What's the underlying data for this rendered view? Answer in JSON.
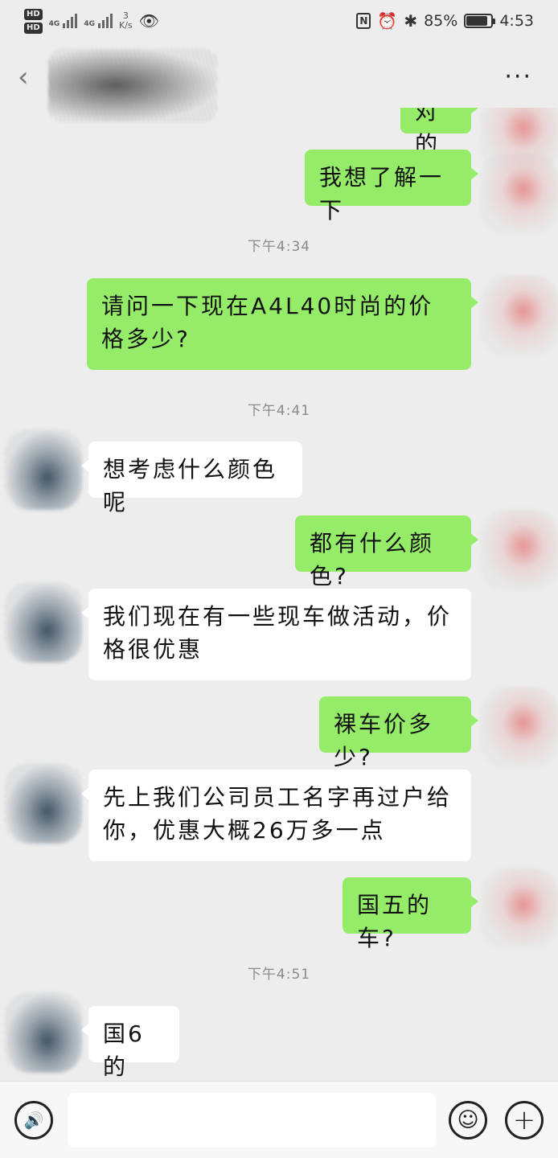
{
  "status_bar": {
    "hd1": "HD",
    "hd2": "HD",
    "net1": "4G",
    "net2": "4G",
    "speed_value": "3",
    "speed_unit": "K/s",
    "battery": "85%",
    "battery_level": 0.85,
    "time": "4:53"
  },
  "header": {
    "back_glyph": "‹",
    "more_glyph": "···"
  },
  "messages": [
    {
      "type": "sent",
      "text": "对的"
    },
    {
      "type": "sent",
      "text": "我想了解一下"
    },
    {
      "type": "time",
      "text": "下午4:34"
    },
    {
      "type": "sent",
      "text": "请问一下现在A4L40时尚的价格多少?"
    },
    {
      "type": "time",
      "text": "下午4:41"
    },
    {
      "type": "recv",
      "text": "想考虑什么颜色呢"
    },
    {
      "type": "sent",
      "text": "都有什么颜色?"
    },
    {
      "type": "recv",
      "text": "我们现在有一些现车做活动，价格很优惠"
    },
    {
      "type": "sent",
      "text": "裸车价多少?"
    },
    {
      "type": "recv",
      "text": "先上我们公司员工名字再过户给你，优惠大概26万多一点"
    },
    {
      "type": "sent",
      "text": "国五的车?"
    },
    {
      "type": "time",
      "text": "下午4:51"
    },
    {
      "type": "recv",
      "text": "国6的"
    }
  ],
  "input_bar": {
    "text_value": "",
    "voice_glyph": "🔊",
    "emoji_glyph": "☺",
    "plus_glyph": "+"
  },
  "colors": {
    "sent_bubble": "#95ec69",
    "recv_bubble": "#ffffff",
    "background": "#ededed"
  }
}
